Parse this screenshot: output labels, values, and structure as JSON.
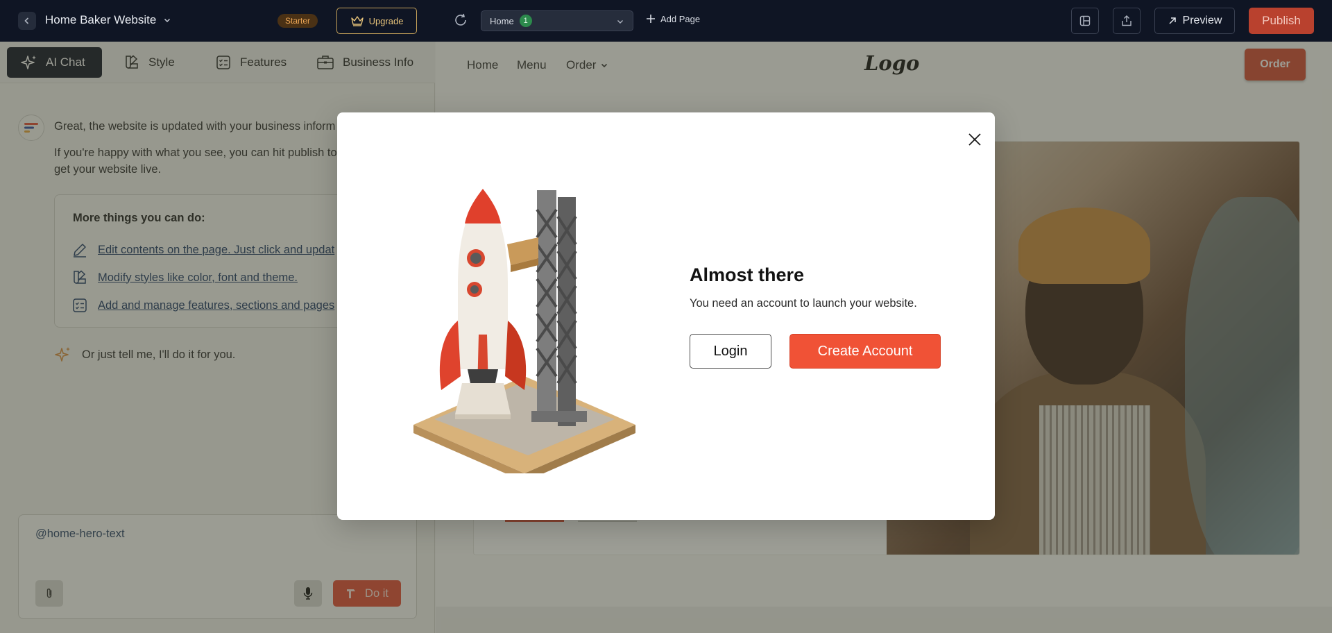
{
  "topbar": {
    "site_title": "Home Baker Website",
    "plan_badge": "Starter",
    "upgrade_label": "Upgrade",
    "page_select": {
      "value": "Home",
      "count": "1"
    },
    "add_page_label": "Add Page",
    "preview_label": "Preview",
    "publish_label": "Publish"
  },
  "left": {
    "tabs": [
      {
        "label": "AI Chat"
      },
      {
        "label": "Style"
      },
      {
        "label": "Features"
      },
      {
        "label": "Business Info"
      }
    ],
    "message_1": "Great, the website is updated with your business inform",
    "message_2": "If you're happy with what you see, you can hit publish to get your website live.",
    "more_title": "More things you can do:",
    "more_items": [
      {
        "label": "Edit contents on the page. Just click and updat"
      },
      {
        "label": "Modify styles like color, font and theme."
      },
      {
        "label": "Add and manage features, sections and pages"
      }
    ],
    "tell_me": "Or just tell me, I'll do it for you.",
    "input_value": "@home-hero-text",
    "do_it_label": "Do it"
  },
  "preview": {
    "nav": {
      "home": "Home",
      "menu": "Menu",
      "order": "Order",
      "logo": "Logo",
      "order_button": "Order"
    }
  },
  "modal": {
    "title": "Almost there",
    "subtitle": "You need an account to launch your website.",
    "login_label": "Login",
    "create_label": "Create Account"
  },
  "colors": {
    "topbar_bg": "#0f1524",
    "accent": "#f05236",
    "publish_bg": "#b9412e",
    "upgrade_border": "#c7a35a"
  }
}
